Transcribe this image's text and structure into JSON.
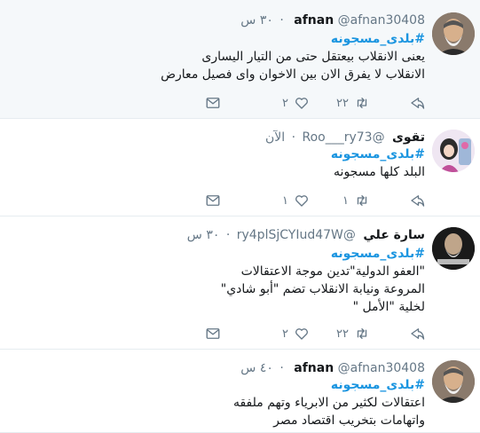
{
  "tweets": [
    {
      "name": "afnan",
      "handle": "@afnan30408",
      "time": "٣٠ س",
      "hashtag": "#بلدى_مسجونه",
      "lines": [
        "يعنى الانقلاب بيعتقل حتى من التيار اليسارى",
        "الانقلاب لا يفرق الان بين الاخوان واى فصيل معارض"
      ],
      "retweets": "٢٢",
      "likes": "٢",
      "avatar_icon": "profile-photo"
    },
    {
      "name": "تقوى",
      "handle": "@Roo___ry73",
      "time": "الآن",
      "hashtag": "#بلدى_مسجونه",
      "lines": [
        "البلد كلها مسجونه"
      ],
      "retweets": "١",
      "likes": "١",
      "avatar_icon": "profile-photo"
    },
    {
      "name": "سارة علي",
      "handle": "@ry4plSjCYIud47W",
      "time": "٣٠ س",
      "hashtag": "#بلدى_مسجونه",
      "lines": [
        "\"العفو الدولية\"تدين موجة الاعتقالات",
        "المروعة ونيابة الانقلاب تضم \"أبو شادي\"",
        "لخلية \"الأمل \""
      ],
      "retweets": "٢٢",
      "likes": "٢",
      "avatar_icon": "profile-photo"
    },
    {
      "name": "afnan",
      "handle": "@afnan30408",
      "time": "٤٠ س",
      "hashtag": "#بلدى_مسجونه",
      "lines": [
        "اعتقالات لكثير من الابرياء وتهم ملفقه",
        "واتهامات بتخريب اقتصاد مصر"
      ],
      "retweets": "",
      "likes": "",
      "avatar_icon": "profile-photo"
    }
  ],
  "icons": {
    "reply": "reply-icon",
    "retweet": "retweet-icon",
    "like": "heart-icon",
    "dm": "envelope-icon"
  },
  "colors": {
    "hashtag": "#1b95e0",
    "secondary_text": "#657786",
    "highlight_bg": "#f5f8fa",
    "divider": "#e6ecf0"
  }
}
